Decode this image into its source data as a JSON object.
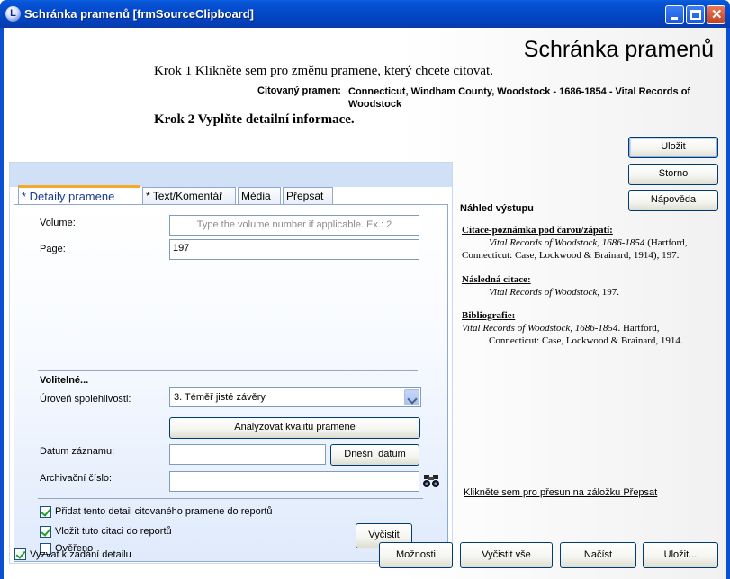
{
  "window": {
    "title": "Schránka pramenů [frmSourceClipboard]",
    "app_icon_letter": "L"
  },
  "header": {
    "big_title": "Schránka pramenů",
    "step1_prefix": "Krok 1",
    "step1_link": "Klikněte sem pro změnu pramene, který chcete citovat.",
    "cited_source_label": "Citovaný pramen:",
    "cited_source_value": "Connecticut, Windham County, Woodstock - 1686-1854 - Vital Records of Woodstock",
    "step2": "Krok 2 Vyplňte detailní informace."
  },
  "tabs": [
    {
      "label": "* Detaily pramene",
      "active": true
    },
    {
      "label": "* Text/Komentář",
      "active": false
    },
    {
      "label": "Média",
      "active": false
    },
    {
      "label": "Přepsat",
      "active": false
    }
  ],
  "details": {
    "volume_label": "Volume:",
    "volume_placeholder": "Type the volume number if applicable. Ex.: 2",
    "page_label": "Page:",
    "page_value": "197",
    "optional_header": "Volitelné...",
    "reliability_label": "Úroveň spolehlivosti:",
    "reliability_value": "3.  Téměř jisté závěry",
    "analyze_button": "Analyzovat kvalitu pramene",
    "record_date_label": "Datum záznamu:",
    "record_date_value": "",
    "today_button": "Dnešní datum",
    "archive_label": "Archivační číslo:",
    "archive_value": "",
    "add_detail_checkbox": "Přidat tento detail citovaného pramene do reportů",
    "insert_citation_checkbox": "Vložit tuto citaci do reportů",
    "verified_checkbox": "Ověřeno",
    "clear_button": "Vyčistit"
  },
  "right_buttons": {
    "save": "Uložit",
    "cancel": "Storno",
    "help": "Nápověda"
  },
  "preview": {
    "title": "Náhled výstupu",
    "footnote_header": "Citace-poznámka pod čarou/zápatí:",
    "footnote_italic": "Vital Records of Woodstock, 1686-1854",
    "footnote_rest": " (Hartford,",
    "footnote_line2": "Connecticut: Case, Lockwood & Brainard, 1914), 197.",
    "subsequent_header": "Následná citace:",
    "subsequent_italic": "Vital Records of Woodstock",
    "subsequent_rest": ", 197.",
    "bibliography_header": "Bibliografie:",
    "bibliography_italic": "Vital Records of Woodstock, 1686-1854",
    "bibliography_rest": ". Hartford,",
    "bibliography_line2": "Connecticut: Case, Lockwood & Brainard, 1914.",
    "override_link": "Klikněte sem pro přesun na záložku Přepsat"
  },
  "footer": {
    "prompt_checkbox": "Vyzvat k zadání detailu",
    "options_button": "Možnosti",
    "clear_all_button": "Vyčistit vše",
    "load_button": "Načíst",
    "save_as_button": "Uložit..."
  }
}
